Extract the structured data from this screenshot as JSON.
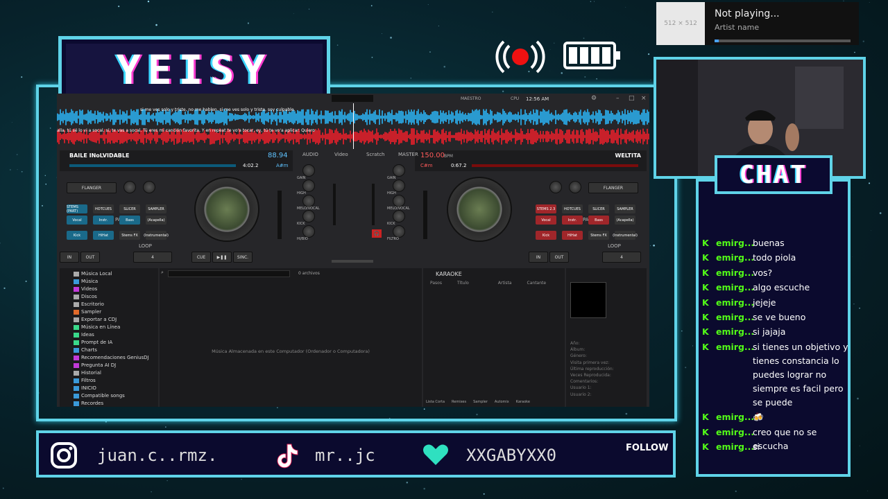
{
  "overlay": {
    "streamer_title": "YEISY",
    "chat_title": "CHAT"
  },
  "now_playing": {
    "art_placeholder": "512 × 512",
    "title": "Not playing...",
    "artist": "Artist name",
    "progress": 0.03
  },
  "vdj": {
    "top": {
      "master_label": "MAESTRO",
      "cpu_label": "CPU",
      "clock": "12:56 AM"
    },
    "lyrics_top": [
      "si",
      "me",
      "ves",
      "solo",
      "y",
      "triste,",
      "no",
      "me",
      "hablen.",
      "si",
      "me",
      "ves",
      "solo",
      "y",
      "triste,",
      "soy",
      "culpable."
    ],
    "lyrics_bottom": [
      "alla.",
      "tú",
      "sé",
      "lo",
      "vi",
      "a",
      "socal,",
      "sí,",
      "te",
      "vas",
      "a",
      "socal.",
      "Tú",
      "eres",
      "mi",
      "canción",
      "favorita.",
      "Y",
      "en",
      "repeat",
      "te",
      "vo'a",
      "tocar,",
      "ey,",
      "tú",
      "te",
      "vo'a",
      "aplicar.",
      "Quiero"
    ],
    "deck_left": {
      "title": "BAILE INoLVIDABLE",
      "bpm": "88.94",
      "time": "4:02.2",
      "key": "A#m",
      "effect": "FLANGER",
      "pad_mode_label": "PADS",
      "pad_modes": [
        "STEMS (PART)",
        "HOTCUES",
        "SLICER",
        "SAMPLER"
      ],
      "pads": [
        "Vocal",
        "Instr.",
        "Bass",
        "(Acapella)",
        "Kick",
        "HiHat",
        "Stems FX",
        "(Instrumental)"
      ],
      "controls": {
        "in": "IN",
        "out": "OUT",
        "cue": "CUE",
        "play": "▶❚❚",
        "sync": "SINC.",
        "loop": "4",
        "loop_label": "LOOP"
      }
    },
    "deck_right": {
      "title": "WELTITA",
      "bpm": "150.00",
      "bpm_label": "BPM",
      "time": "0:67.2",
      "key": "C#m",
      "effect": "FLANGER",
      "pad_mode_label": "PADS",
      "pad_modes": [
        "STEMS 2.3",
        "HOTCUES",
        "SLICER",
        "SAMPLER"
      ],
      "pads": [
        "Vocal",
        "Instr.",
        "Bass",
        "(Acapella)",
        "Kick",
        "HiHat",
        "Stems FX",
        "(Instrumental)"
      ],
      "controls": {
        "in": "IN",
        "out": "OUT",
        "cue": "CUE",
        "play": "▶❚❚",
        "sync": "SINC.",
        "loop": "4",
        "loop_label": "LOOP"
      }
    },
    "mixer": {
      "labels": [
        "AUDIO",
        "Video",
        "Scratch",
        "MASTER"
      ],
      "eq_left": [
        "GAIN",
        "HIGH",
        "MELO/VOCAL",
        "KICK",
        "HI/BIO"
      ],
      "eq_right": [
        "GAIN",
        "HIGH",
        "MELO/VOCAL",
        "KICK",
        "FILTRO"
      ]
    },
    "browser": {
      "tree": [
        {
          "label": "Música Local",
          "color": "#aaa"
        },
        {
          "label": "Música",
          "color": "#3a9ad9"
        },
        {
          "label": "Videos",
          "color": "#c23ad9"
        },
        {
          "label": "Discos",
          "color": "#aaa"
        },
        {
          "label": "Escritorio",
          "color": "#aaa"
        },
        {
          "label": "Sampler",
          "color": "#e06a2a"
        },
        {
          "label": "Exportar a CDJ",
          "color": "#aaa"
        },
        {
          "label": "Música en Línea",
          "color": "#3ad98a"
        },
        {
          "label": "Ideas",
          "color": "#3ad98a"
        },
        {
          "label": "Prompt de IA",
          "color": "#3ad98a"
        },
        {
          "label": "Charts",
          "color": "#3a9ad9"
        },
        {
          "label": "Recomendaciones GeniusDJ",
          "color": "#c23ad9"
        },
        {
          "label": "Pregunta AI DJ",
          "color": "#c23ad9"
        },
        {
          "label": "Historial",
          "color": "#aaa"
        },
        {
          "label": "Filtros",
          "color": "#3a9ad9"
        },
        {
          "label": "INICIO",
          "color": "#3a9ad9"
        },
        {
          "label": "Compatible songs",
          "color": "#3a9ad9"
        },
        {
          "label": "Recordes",
          "color": "#3a9ad9"
        }
      ],
      "files_count": "0 archivos",
      "empty_message": "Música Almacenada en este Computador (Ordenador o Computadora)",
      "karaoke_title": "KARAOKE",
      "karaoke_columns": [
        "Pasos",
        "Título",
        "Artista",
        "Cantante"
      ],
      "bottom_tabs": [
        "Lista Corta",
        "Remixes",
        "Sampler",
        "Automix",
        "Karaoke"
      ],
      "info_fields": [
        "Año:",
        "Álbum:",
        "Género:",
        "Visita primera vez:",
        "Última reproducción:",
        "Veces Reproducida:",
        "Comentarios:",
        "Usuario 1:",
        "Usuario 2:"
      ]
    }
  },
  "chat": {
    "messages": [
      {
        "user": "emirg...",
        "text": "buenas"
      },
      {
        "user": "emirg...",
        "text": "todo piola"
      },
      {
        "user": "emirg...",
        "text": "vos?"
      },
      {
        "user": "emirg...",
        "text": "algo escuche"
      },
      {
        "user": "emirg...",
        "text": "jejeje"
      },
      {
        "user": "emirg...",
        "text": "se ve bueno"
      },
      {
        "user": "emirg...",
        "text": "si jajaja"
      },
      {
        "user": "emirg...",
        "text": "si tienes un objetivo y tienes constancia lo puedes lograr no siempre es facil pero se puede"
      },
      {
        "user": "emirg...",
        "text": "🍻"
      },
      {
        "user": "emirg...",
        "text": "creo que no se escucha"
      },
      {
        "user": "emirg...",
        "text": "si"
      }
    ]
  },
  "social": {
    "instagram": "juan.c..rmz.",
    "tiktok": "mr..jc",
    "kick": "XXGABYXX0",
    "follow": "FOLLOW"
  }
}
